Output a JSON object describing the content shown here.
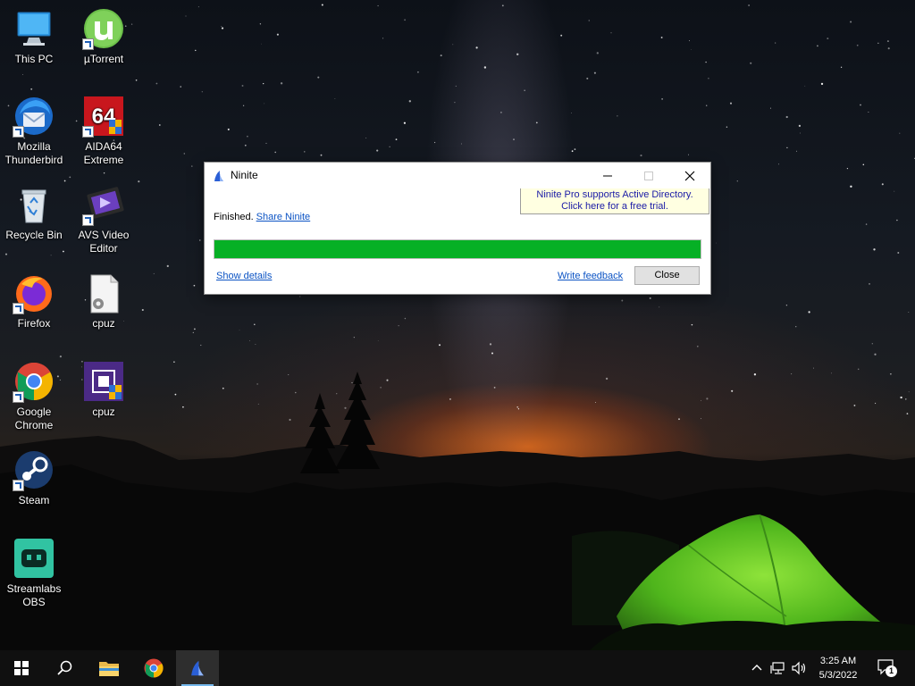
{
  "desktop": {
    "icons": [
      {
        "label": "This PC",
        "icon": "this-pc-icon"
      },
      {
        "label": "µTorrent",
        "icon": "utorrent-icon"
      },
      {
        "label": "Mozilla Thunderbird",
        "icon": "thunderbird-icon"
      },
      {
        "label": "AIDA64 Extreme",
        "icon": "aida64-icon"
      },
      {
        "label": "Recycle Bin",
        "icon": "recycle-bin-icon"
      },
      {
        "label": "AVS Video Editor",
        "icon": "avs-video-editor-icon"
      },
      {
        "label": "Firefox",
        "icon": "firefox-icon"
      },
      {
        "label": "cpuz",
        "icon": "file-icon"
      },
      {
        "label": "Google Chrome",
        "icon": "chrome-icon"
      },
      {
        "label": "cpuz",
        "icon": "cpuz-icon"
      },
      {
        "label": "Steam",
        "icon": "steam-icon"
      },
      {
        "label": "Streamlabs OBS",
        "icon": "streamlabs-obs-icon"
      }
    ]
  },
  "window": {
    "title": "Ninite",
    "promo_line1": "Ninite Pro supports Active Directory.",
    "promo_line2": "Click here for a free trial.",
    "status_text": "Finished.",
    "share_link": "Share Ninite",
    "progress_fraction": 1.0,
    "progress_color": "#06b025",
    "show_details": "Show details",
    "write_feedback": "Write feedback",
    "close_label": "Close"
  },
  "taskbar": {
    "items": [
      "start-icon",
      "search-icon",
      "file-explorer-icon",
      "chrome-icon",
      "ninite-icon"
    ],
    "active_item": "ninite-icon",
    "time": "3:25 AM",
    "date": "5/3/2022",
    "notification_count": "1"
  }
}
